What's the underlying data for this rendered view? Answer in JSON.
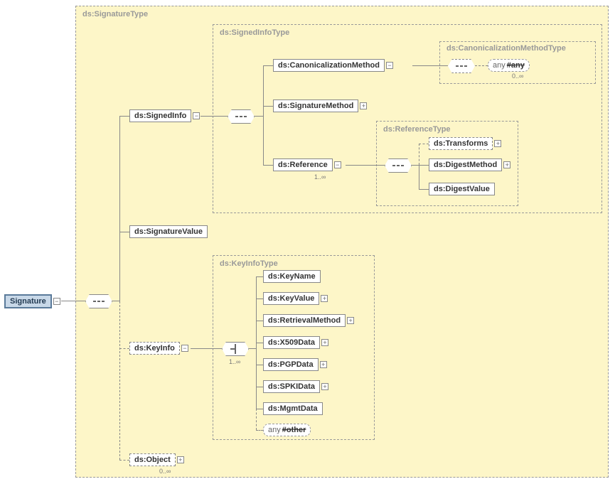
{
  "root": {
    "label": "Signature"
  },
  "types": {
    "signature": "ds:SignatureType",
    "signedInfo": "ds:SignedInfoType",
    "canon": "ds:CanonicalizationMethodType",
    "reference": "ds:ReferenceType",
    "keyInfo": "ds:KeyInfoType"
  },
  "nodes": {
    "signedInfo": "ds:SignedInfo",
    "signatureValue": "ds:SignatureValue",
    "keyInfo": "ds:KeyInfo",
    "object": "ds:Object",
    "canonMethod": "ds:CanonicalizationMethod",
    "sigMethod": "ds:SignatureMethod",
    "reference": "ds:Reference",
    "transforms": "ds:Transforms",
    "digestMethod": "ds:DigestMethod",
    "digestValue": "ds:DigestValue",
    "keyName": "ds:KeyName",
    "keyValue": "ds:KeyValue",
    "retrievalMethod": "ds:RetrievalMethod",
    "x509": "ds:X509Data",
    "pgp": "ds:PGPData",
    "spki": "ds:SPKIData",
    "mgmt": "ds:MgmtData"
  },
  "any": {
    "canon": {
      "prefix": "any",
      "kind": "#any"
    },
    "keyInfo": {
      "prefix": "any",
      "kind": "#other"
    }
  },
  "occurs": {
    "zeroInf": "0..∞",
    "oneInf": "1..∞"
  }
}
